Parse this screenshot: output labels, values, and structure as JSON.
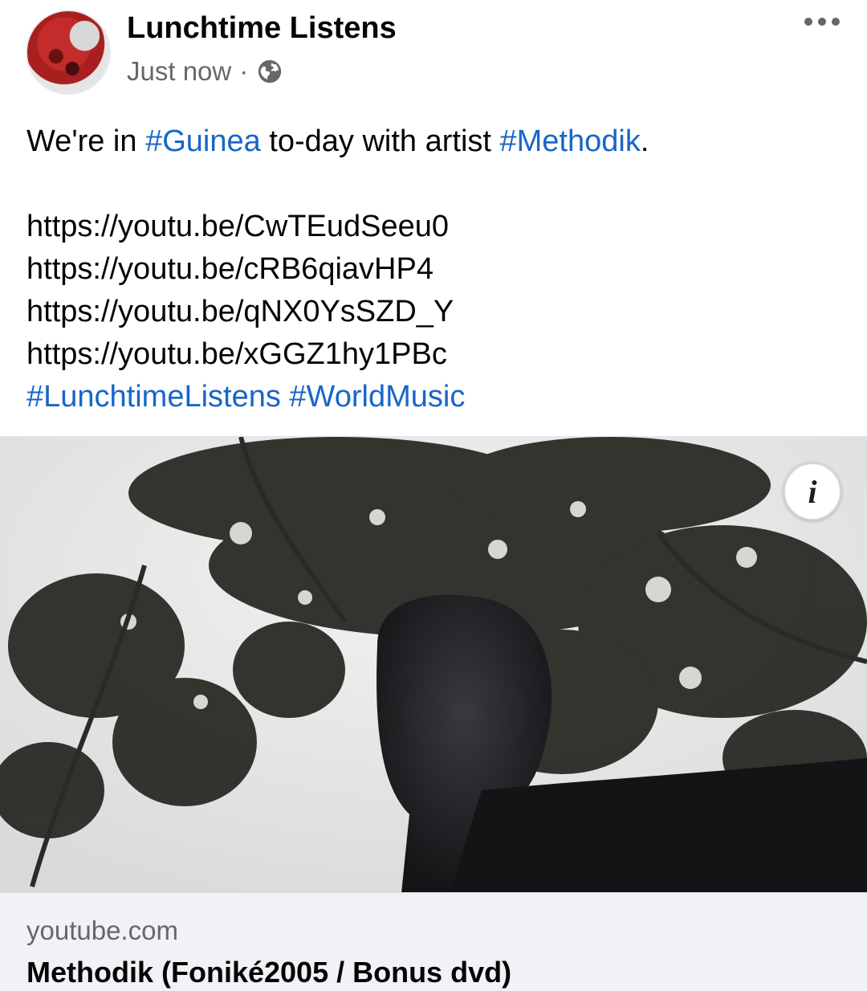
{
  "post": {
    "author": "Lunchtime Listens",
    "timestamp": "Just now",
    "separator": "·",
    "privacy_icon": "globe-icon",
    "more_icon": "more-horizontal-icon",
    "text": {
      "line1_pre": "We're in ",
      "line1_tag1": "#Guinea",
      "line1_mid": " to-day with artist ",
      "line1_tag2": "#Methodik",
      "line1_post": ".",
      "links": [
        "https://youtu.be/CwTEudSeeu0",
        "https://youtu.be/cRB6qiavHP4",
        "https://youtu.be/qNX0YsSZD_Y",
        "https://youtu.be/xGGZ1hy1PBc"
      ],
      "tag3": "#LunchtimeListens",
      "tag4": "#WorldMusic"
    },
    "media": {
      "info_button": "i",
      "info_icon": "info-icon"
    },
    "preview": {
      "domain": "youtube.com",
      "title": "Methodik (Foniké2005 / Bonus dvd)"
    },
    "colors": {
      "hashtag": "#1766c7",
      "secondary_text": "#65676b",
      "preview_background": "#f0f2f5"
    }
  }
}
